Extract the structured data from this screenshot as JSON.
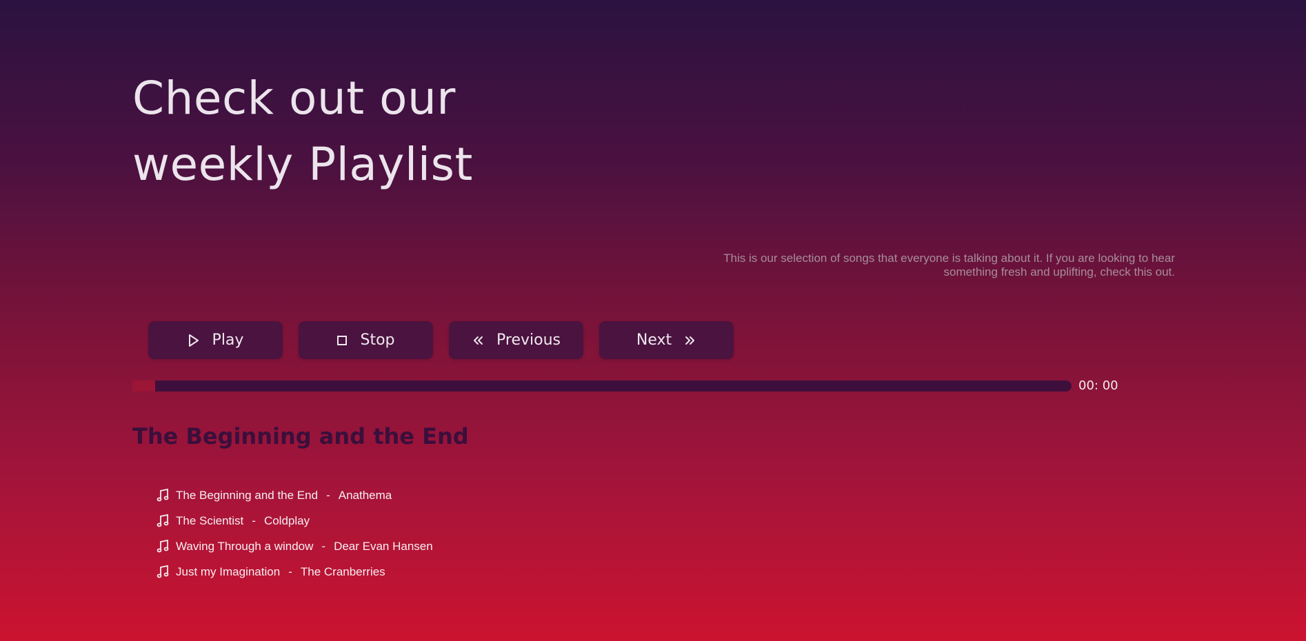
{
  "hero": {
    "title_line1": "Check out our",
    "title_line2": "weekly Playlist",
    "description": "This is our selection of songs that everyone is talking about it. If you are looking to hear something fresh and uplifting, check this out."
  },
  "controls": {
    "play_label": "Play",
    "stop_label": "Stop",
    "previous_label": "Previous",
    "next_label": "Next"
  },
  "player": {
    "progress": 0.024,
    "time": "00: 00",
    "now_playing": "The Beginning and the End"
  },
  "tracks": [
    {
      "title": "The Beginning and the End",
      "separator": "-",
      "artist": "Anathema"
    },
    {
      "title": "The Scientist",
      "separator": "-",
      "artist": "Coldplay"
    },
    {
      "title": "Waving Through a window",
      "separator": "-",
      "artist": "Dear Evan Hansen"
    },
    {
      "title": "Just my Imagination",
      "separator": "-",
      "artist": "The Cranberries"
    }
  ],
  "icons": {
    "play": "play-icon",
    "stop": "stop-icon",
    "previous": "double-chevron-left-icon",
    "next": "double-chevron-right-icon",
    "track": "music-note-icon"
  },
  "colors": {
    "button_bg": "#4a1340",
    "progress_track": "#3e0f3c",
    "progress_fill": "#9c1535",
    "heading_dark": "#3a0f3c"
  }
}
